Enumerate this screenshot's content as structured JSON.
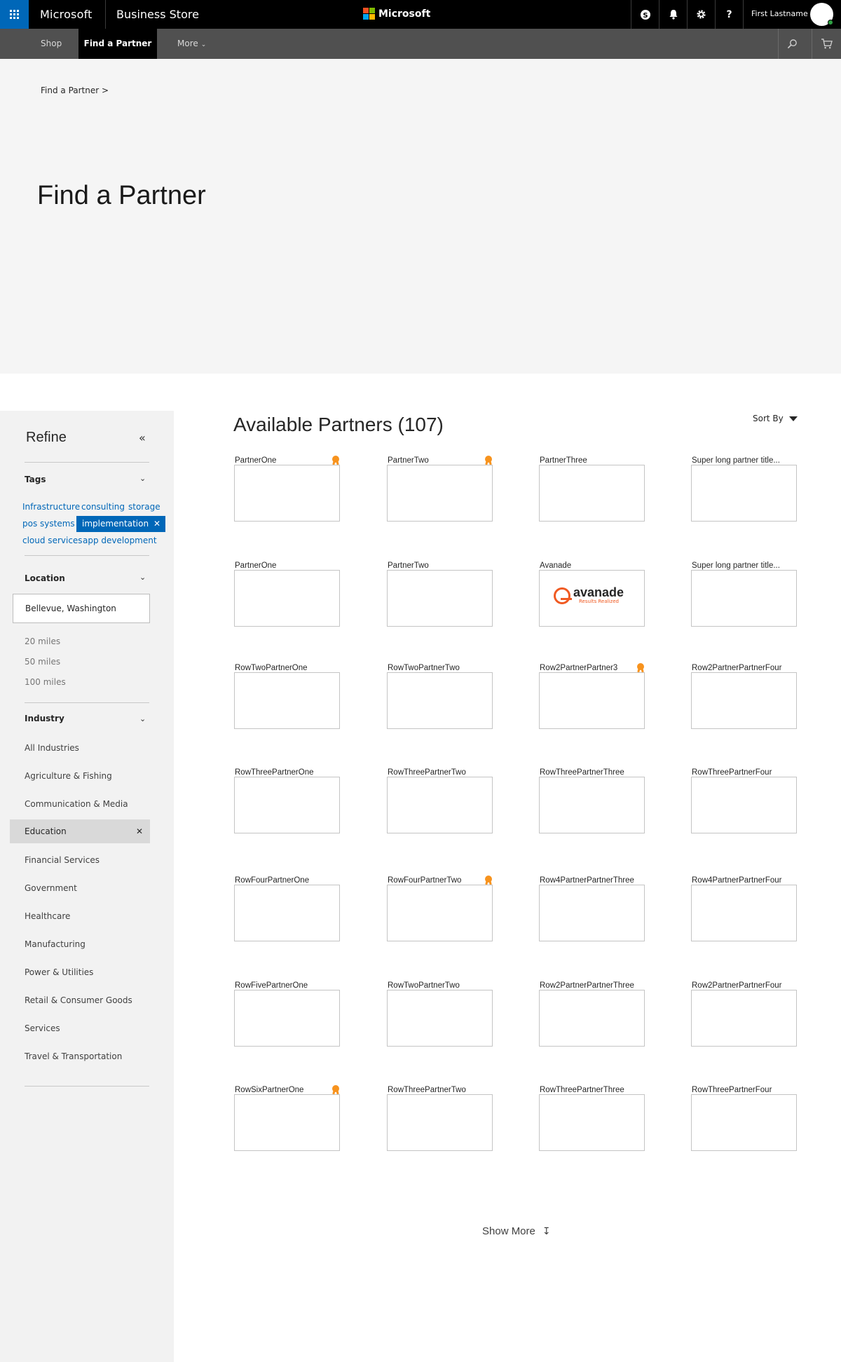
{
  "topbar": {
    "brand": "Microsoft",
    "app_name": "Business Store",
    "center_logo": "Microsoft",
    "user_name": "First Lastname",
    "icons": [
      "skype-icon",
      "bell-icon",
      "gear-icon",
      "help-icon"
    ],
    "help_glyph": "?"
  },
  "nav": {
    "shop": "Shop",
    "find_partner": "Find a Partner",
    "more": "More"
  },
  "hero": {
    "breadcrumb": "Find a Partner >",
    "title": "Find a Partner"
  },
  "sidebar": {
    "refine": "Refine",
    "tags_label": "Tags",
    "tags": [
      "Infrastructure",
      "consulting",
      "storage",
      "pos systems",
      "implementation",
      "cloud services",
      "app development"
    ],
    "selected_tag": "implementation",
    "location_label": "Location",
    "location_value": "Bellevue, Washington",
    "miles": [
      "20 miles",
      "50 miles",
      "100 miles"
    ],
    "industry_label": "Industry",
    "industries": [
      "All Industries",
      "Agriculture & Fishing",
      "Communication & Media",
      "Education",
      "Financial Services",
      "Government",
      "Healthcare",
      "Manufacturing",
      "Power & Utilities",
      "Retail & Consumer Goods",
      "Services",
      "Travel & Transportation"
    ],
    "selected_industry": "Education"
  },
  "main": {
    "title": "Available Partners (107)",
    "sort_by": "Sort By",
    "show_more": "Show More",
    "partners": [
      [
        "PartnerOne",
        "PartnerTwo",
        "PartnerThree",
        "Super long partner title..."
      ],
      [
        "PartnerOne",
        "PartnerTwo",
        "Avanade",
        "Super long partner title..."
      ],
      [
        "RowTwoPartnerOne",
        "RowTwoPartnerTwo",
        "Row2PartnerPartner3",
        "Row2PartnerPartnerFour"
      ],
      [
        "RowThreePartnerOne",
        "RowThreePartnerTwo",
        "RowThreePartnerThree",
        "RowThreePartnerFour"
      ],
      [
        "RowFourPartnerOne",
        "RowFourPartnerTwo",
        "Row4PartnerPartnerThree",
        "Row4PartnerPartnerFour"
      ],
      [
        "RowFivePartnerOne",
        "RowTwoPartnerTwo",
        "Row2PartnerPartnerThree",
        "Row2PartnerPartnerFour"
      ],
      [
        "RowSixPartnerOne",
        "RowThreePartnerTwo",
        "RowThreePartnerThree",
        "RowThreePartnerFour"
      ]
    ],
    "avanade_logo_word": "avanade",
    "avanade_logo_tagline": "Results Realized"
  },
  "colors": {
    "accent": "#0067b8",
    "badge": "#f7931e",
    "avanade": "#f05a22"
  }
}
